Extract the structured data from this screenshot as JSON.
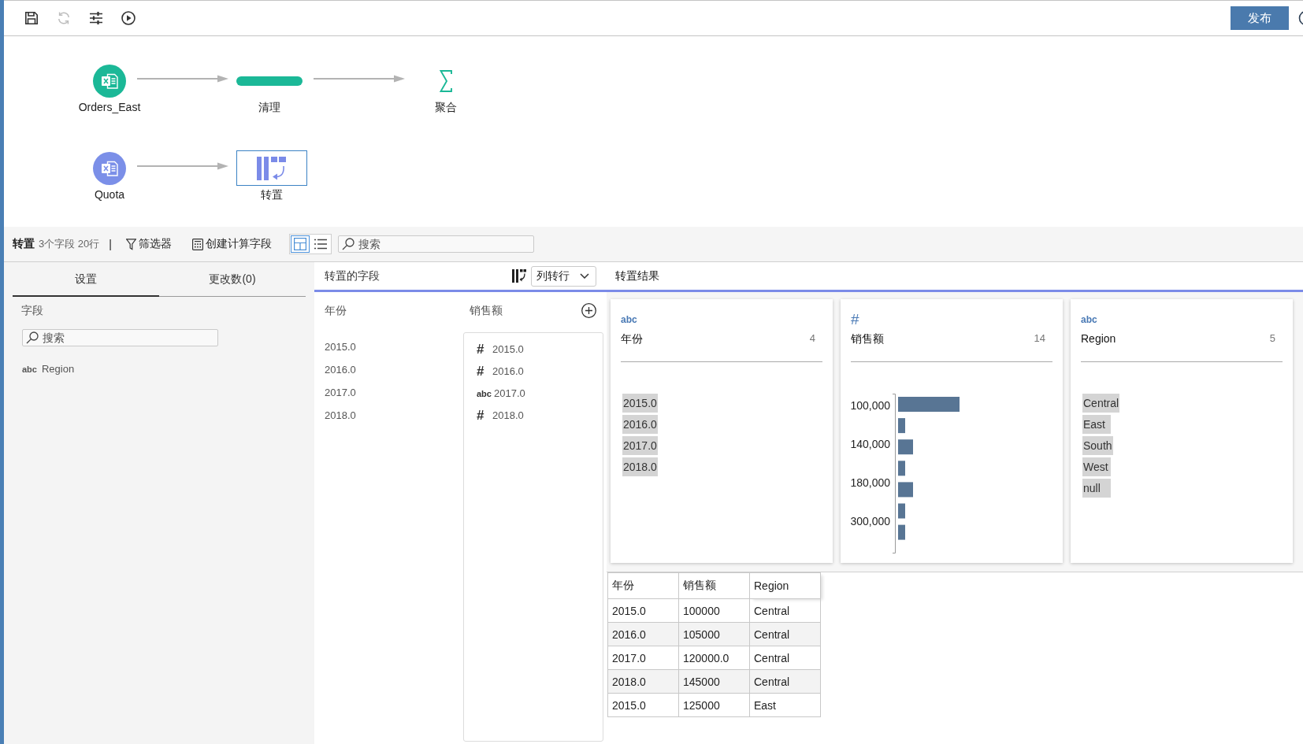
{
  "toolbar": {
    "buttons": [
      {
        "kind": "save",
        "disabled": false
      },
      {
        "kind": "refresh",
        "disabled": true
      },
      {
        "kind": "adjust",
        "disabled": false
      },
      {
        "kind": "run",
        "disabled": false
      }
    ],
    "publish_button": "发布"
  },
  "flow": {
    "lanes": [
      {
        "nodes": [
          {
            "kind": "source",
            "label": "Orders_East",
            "color": "#1bb897",
            "selected": false
          },
          {
            "kind": "clean",
            "label": "清理",
            "color": "#1bb897",
            "selected": false
          },
          {
            "kind": "aggregate",
            "label": "聚合",
            "color": "#1bb897",
            "selected": false
          }
        ]
      },
      {
        "nodes": [
          {
            "kind": "source",
            "label": "Quota",
            "color": "#7b8fe8",
            "selected": false
          },
          {
            "kind": "pivot",
            "label": "转置",
            "color": "#7b8be8",
            "selected": true
          }
        ]
      }
    ]
  },
  "step_bar": {
    "title": "转置",
    "summary": "3个字段 20行",
    "separator": "|",
    "actions": [
      {
        "kind": "filter",
        "label": "筛选器"
      },
      {
        "kind": "calculation",
        "label": "创建计算字段"
      }
    ],
    "view_modes": [
      {
        "kind": "cards",
        "selected": true
      },
      {
        "kind": "list",
        "selected": false
      }
    ],
    "search": {
      "placeholder": "搜索"
    }
  },
  "settings_panel": {
    "tabs": [
      {
        "label": "设置",
        "selected": true
      },
      {
        "label": "更改数(0)",
        "selected": false
      }
    ],
    "fields_heading": "字段",
    "search": {
      "placeholder": "搜索"
    },
    "fields": [
      {
        "type_mark": "abc",
        "name": "Region"
      }
    ]
  },
  "pivot_fields": {
    "title": "转置的字段",
    "mode_dropdown": {
      "value": "列转行"
    },
    "name_column": {
      "heading": "年份",
      "values": [
        "2015.0",
        "2016.0",
        "2017.0",
        "2018.0"
      ]
    },
    "value_column": {
      "heading": "销售额",
      "items": [
        {
          "type_mark": "#",
          "label": "2015.0"
        },
        {
          "type_mark": "#",
          "label": "2016.0"
        },
        {
          "type_mark": "abc",
          "label": "2017.0"
        },
        {
          "type_mark": "#",
          "label": "2018.0"
        }
      ]
    }
  },
  "results": {
    "title": "转置结果",
    "profile_cards": [
      {
        "kind": "list",
        "type_mark": "abc",
        "name": "年份",
        "count": "4",
        "values": [
          "2015.0",
          "2016.0",
          "2017.0",
          "2018.0"
        ]
      },
      {
        "kind": "histogram",
        "type_mark": "#",
        "name": "销售额",
        "count": "14",
        "axis_labels": [
          "100,000",
          "140,000",
          "180,000",
          "300,000"
        ]
      },
      {
        "kind": "list",
        "type_mark": "abc",
        "name": "Region",
        "count": "5",
        "values": [
          "Central",
          "East",
          "South",
          "West",
          "null"
        ]
      }
    ],
    "table": {
      "columns": [
        "年份",
        "销售额",
        "Region"
      ],
      "rows": [
        [
          "2015.0",
          "100000",
          "Central"
        ],
        [
          "2016.0",
          "105000",
          "Central"
        ],
        [
          "2017.0",
          "120000.0",
          "Central"
        ],
        [
          "2018.0",
          "145000",
          "Central"
        ],
        [
          "2015.0",
          "125000",
          "East"
        ]
      ]
    }
  }
}
